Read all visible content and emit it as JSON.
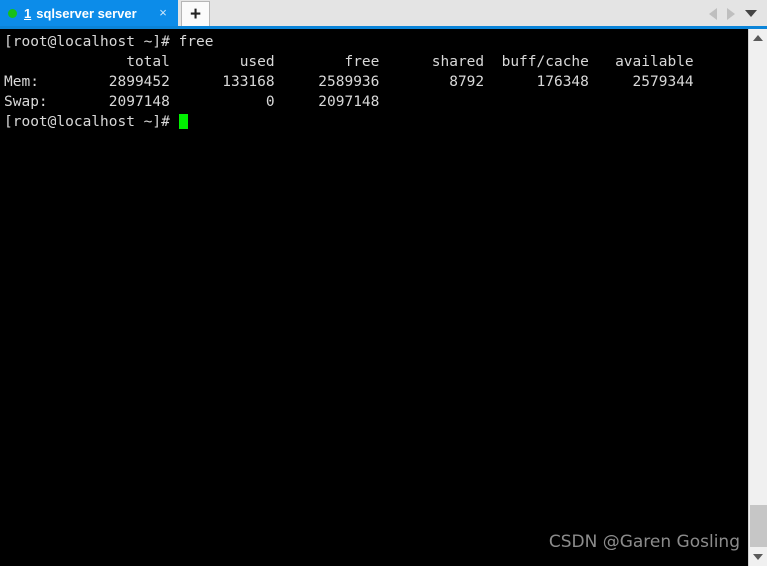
{
  "window": {
    "tab": {
      "index": "1",
      "title": "sqlserver server",
      "status_dot": "connected-dot",
      "close_label": "×",
      "dot_color": "#18c018",
      "active_color": "#0c8ce9"
    },
    "new_tab_label": "+",
    "controls": {
      "prev_label": "prev-tab-arrow",
      "next_label": "next-tab-arrow",
      "menu_label": "tab-list-chevron"
    }
  },
  "terminal": {
    "prompt": "[root@localhost ~]#",
    "command": "free",
    "line_command": "[root@localhost ~]# free",
    "headers": "              total        used        free      shared  buff/cache   available",
    "rows": [
      "Mem:        2899452      133168     2589936        8792      176348     2579344",
      "Swap:       2097148           0     2097148"
    ],
    "line_prompt_idle": "[root@localhost ~]# ",
    "cursor": "block-cursor",
    "cursor_color": "#00f000",
    "background": "#000000",
    "foreground": "#d8d8d8",
    "table": {
      "columns": [
        "",
        "total",
        "used",
        "free",
        "shared",
        "buff/cache",
        "available"
      ],
      "data": [
        [
          "Mem:",
          "2899452",
          "133168",
          "2589936",
          "8792",
          "176348",
          "2579344"
        ],
        [
          "Swap:",
          "2097148",
          "0",
          "2097148",
          "",
          "",
          ""
        ]
      ]
    }
  },
  "watermark": {
    "text": "CSDN @Garen Gosling"
  },
  "scrollbar": {
    "up_label": "scroll-up",
    "down_label": "scroll-down",
    "thumb_label": "scroll-thumb"
  }
}
